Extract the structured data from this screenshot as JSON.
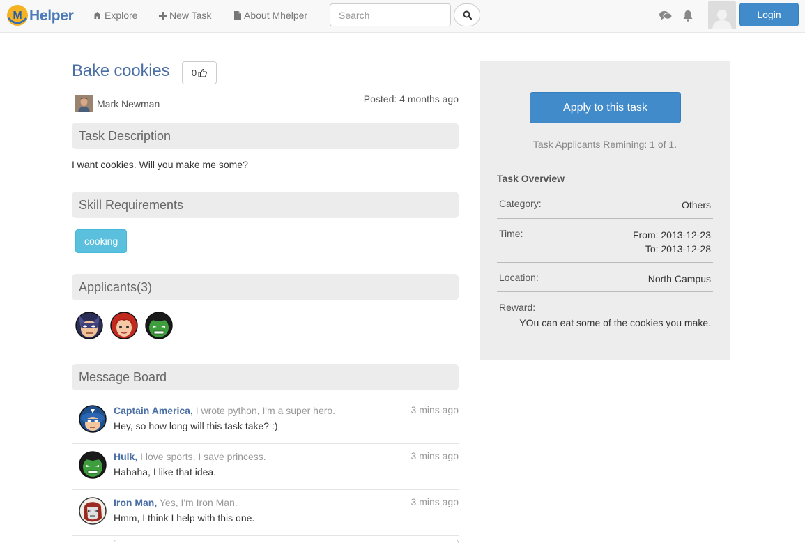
{
  "nav": {
    "brand": "Helper",
    "brand_initial": "M",
    "explore": "Explore",
    "new_task": "New Task",
    "about": "About Mhelper",
    "search_placeholder": "Search",
    "login": "Login"
  },
  "task": {
    "title": "Bake cookies",
    "likes": "0",
    "author": "Mark Newman",
    "posted": "Posted: 4 months ago",
    "description_heading": "Task Description",
    "description": "I want cookies. Will you make me some?",
    "skills_heading": "Skill Requirements",
    "skills": [
      "cooking"
    ],
    "applicants_heading": "Applicants(3)",
    "message_heading": "Message Board"
  },
  "messages": [
    {
      "name": "Captain America,",
      "bio": " I wrote python, I'm a super hero.",
      "time": "3 mins ago",
      "text": "Hey, so how long will this task take? :)"
    },
    {
      "name": "Hulk,",
      "bio": " I love sports, I save princess.",
      "time": "3 mins ago",
      "text": "Hahaha, I like that idea."
    },
    {
      "name": "Iron Man,",
      "bio": " Yes, I'm Iron Man.",
      "time": "3 mins ago",
      "text": "Hmm, I think I help with this one."
    }
  ],
  "panel": {
    "apply": "Apply to this task",
    "remaining": "Task Applicants Remining: 1 of 1.",
    "overview_title": "Task Overview",
    "category_label": "Category:",
    "category": "Others",
    "time_label": "Time:",
    "time_from": "From: 2013-12-23",
    "time_to": "To: 2013-12-28",
    "location_label": "Location:",
    "location": "North Campus",
    "reward_label": "Reward:",
    "reward": "YOu can eat some of the cookies you make."
  },
  "colors": {
    "brand": "#4a7ab8",
    "primary": "#428bca",
    "info": "#5bc0de",
    "title": "#4a6fa5"
  }
}
